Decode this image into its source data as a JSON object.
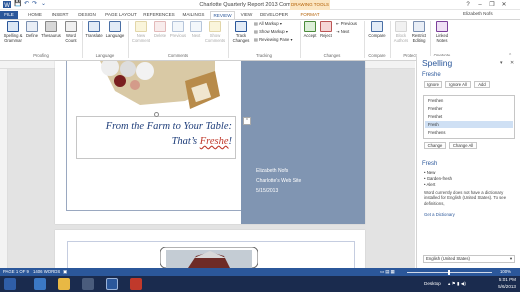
{
  "window": {
    "title": "Charlotte Quarterly Report 2013 Complete - Word",
    "help": "?",
    "min": "–",
    "restore": "❐",
    "close": "✕"
  },
  "qat": {
    "save": "💾",
    "undo": "↶",
    "redo": "↷",
    "more": "⌄"
  },
  "contextual": {
    "label": "DRAWING TOOLS"
  },
  "tabs": [
    "FILE",
    "HOME",
    "INSERT",
    "DESIGN",
    "PAGE LAYOUT",
    "REFERENCES",
    "MAILINGS",
    "REVIEW",
    "VIEW",
    "DEVELOPER",
    "FORMAT"
  ],
  "user": "Elizabeth Nofs",
  "ribbon": {
    "proofing": {
      "label": "Proofing",
      "spelling": "Spelling & Grammar",
      "define": "Define",
      "thesaurus": "Thesaurus",
      "wordcount": "Word Count"
    },
    "language": {
      "label": "Language",
      "translate": "Translate",
      "language": "Language"
    },
    "comments": {
      "label": "Comments",
      "new": "New Comment",
      "delete": "Delete",
      "previous": "Previous",
      "next": "Next",
      "show": "Show Comments"
    },
    "tracking": {
      "label": "Tracking",
      "track": "Track Changes",
      "allmarkup": "All Markup",
      "showmarkup": "Show Markup",
      "reviewing": "Reviewing Pane"
    },
    "changes": {
      "label": "Changes",
      "accept": "Accept",
      "reject": "Reject",
      "previous": "Previous",
      "next": "Next"
    },
    "compare": {
      "label": "Compare",
      "compare": "Compare"
    },
    "protect": {
      "label": "Protect",
      "block": "Block Authors",
      "restrict": "Restrict Editing"
    },
    "onenote": {
      "label": "OneNote",
      "linked": "Linked Notes"
    }
  },
  "document": {
    "headline_line1": "From the Farm to Your Table:",
    "headline_line2a": "That’s ",
    "headline_word": "Freshe",
    "headline_end": "!",
    "author": "Elizabeth Nofs",
    "site": "Charlotte's Web Site",
    "date": "5/15/2013"
  },
  "spelling_pane": {
    "title": "Spelling",
    "word": "Freshe",
    "ignore": "Ignore",
    "ignore_all": "Ignore All",
    "add": "Add",
    "suggestions": [
      "Freshen",
      "Fresher",
      "Freshet",
      "Fresh",
      "Freshens"
    ],
    "selected": "Fresh",
    "change": "Change",
    "change_all": "Change All",
    "def_word": "Fresh",
    "synonyms": [
      "New",
      "Garden-fresh",
      "Alert"
    ],
    "note": "Word currently does not have a dictionary installed for English (United States). To see definitions,",
    "dict_link": "Get a Dictionary",
    "language": "English (United States)"
  },
  "status": {
    "page": "PAGE 1 OF 9",
    "words": "1406 WORDS",
    "zoom": "100%"
  },
  "taskbar": {
    "desktop": "Desktop",
    "time": "5:01 PM",
    "date": "5/6/2013"
  },
  "colors": {
    "accent": "#2b579a",
    "panel": "#8095b2",
    "spell": "#c0392b",
    "contextual": "#fbe6c2"
  }
}
